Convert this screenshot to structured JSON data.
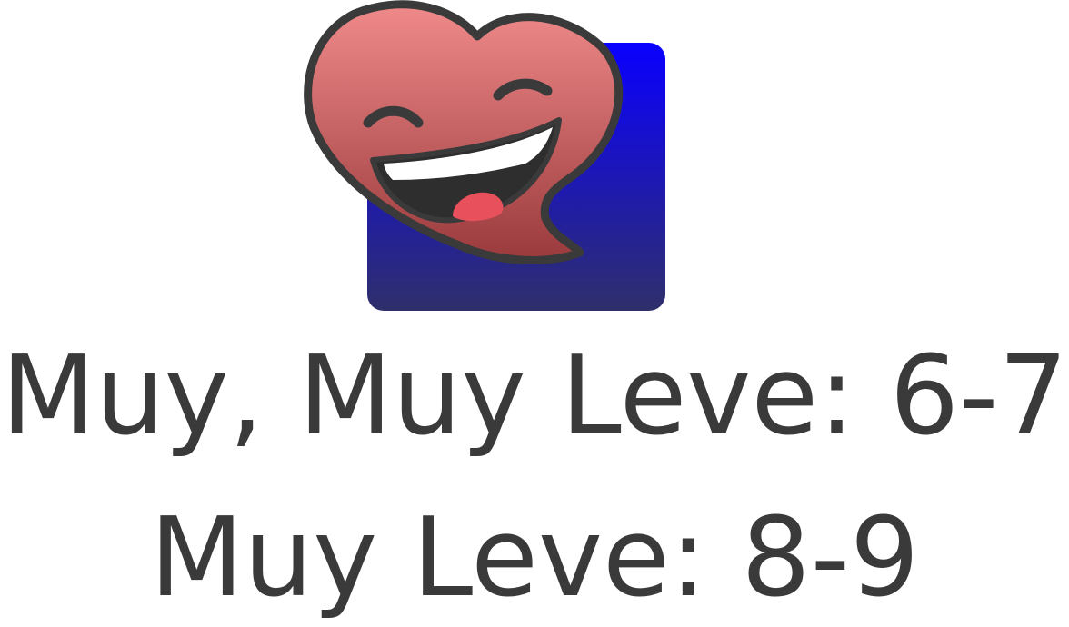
{
  "illustration": {
    "icon": "laughing-heart-icon",
    "background_colors": {
      "top": "#0a00ff",
      "bottom": "#2f2f6b"
    },
    "heart_colors": {
      "top": "#f08a8a",
      "bottom": "#9a3a3c",
      "outline": "#3a3a3a",
      "tongue": "#e8505c"
    }
  },
  "caption": {
    "line1": "Muy, Muy Leve: 6-7",
    "line2": "Muy Leve: 8-9",
    "text_color": "#3a3a3a"
  }
}
